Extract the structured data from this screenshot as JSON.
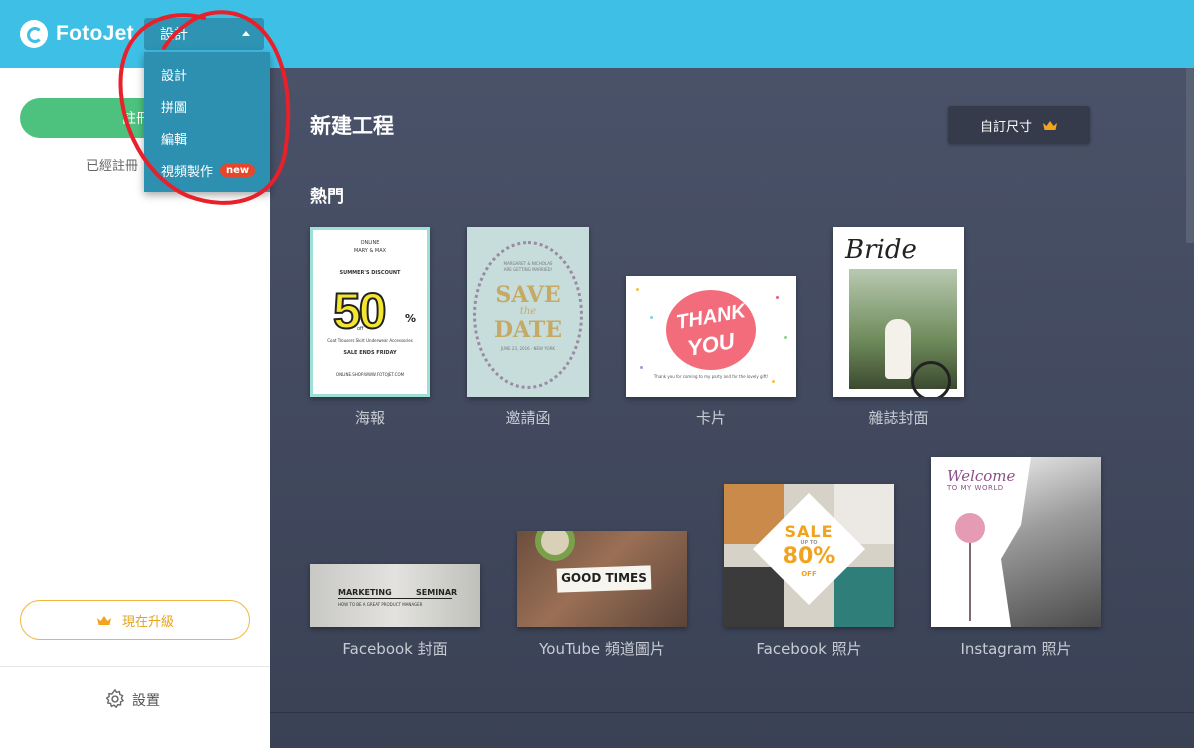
{
  "app": {
    "logo_text": "FotoJet",
    "mode_select_value": "設計"
  },
  "dropdown": {
    "items": [
      {
        "label": "設計"
      },
      {
        "label": "拼圖"
      },
      {
        "label": "編輯"
      },
      {
        "label": "視頻製作",
        "badge": "new"
      }
    ]
  },
  "sidebar": {
    "register_label": "註冊",
    "registered_text": "已經註冊",
    "upgrade_label": "現在升級",
    "settings_label": "設置"
  },
  "main": {
    "title": "新建工程",
    "custom_size_label": "自訂尺寸",
    "section_title": "熱門",
    "templates": [
      {
        "caption": "海報"
      },
      {
        "caption": "邀請函"
      },
      {
        "caption": "卡片"
      },
      {
        "caption": "雜誌封面"
      },
      {
        "caption": "Facebook 封面"
      },
      {
        "caption": "YouTube 頻道圖片"
      },
      {
        "caption": "Facebook 照片"
      },
      {
        "caption": "Instagram 照片"
      }
    ]
  },
  "thumbs": {
    "poster": {
      "top1": "ONLINE",
      "top2": "MARY & MAX",
      "discount": "SUMMER'S DISCOUNT",
      "big": "50",
      "pct": "%",
      "off": "off",
      "cats": "Coat   Trousers   Skirt   Underwear   Accessories",
      "ends": "SALE ENDS FRIDAY",
      "url": "ONLINE.SHOP.WWW.FOTOJET.COM"
    },
    "invite": {
      "names": "MARGARET & NICHOLAS",
      "getting": "ARE GETTING MARRIED!",
      "save": "SAVE",
      "the": "the",
      "date": "DATE",
      "when": "JUNE 23, 2016 · NEW YORK"
    },
    "card": {
      "thank": "THANK",
      "you": "YOU",
      "note": "Thank you for coming to my party and for the lovely gift!"
    },
    "magazine": {
      "title": "Bride"
    },
    "fbcover": {
      "left": "MARKETING",
      "right": "SEMINAR",
      "sub": "HOW TO BE A GREAT PRODUCT MANAGER"
    },
    "youtube": {
      "text": "GOOD TIMES"
    },
    "fbphoto": {
      "sale": "SALE",
      "up": "UP TO",
      "pct": "80%",
      "off": "OFF"
    },
    "insta": {
      "welcome": "Welcome",
      "sub": "TO MY WORLD"
    }
  },
  "colors": {
    "topbar": "#3ec0e6",
    "dropdown": "#2d90b1",
    "register_green": "#4cc27e",
    "upgrade_gold": "#f0b73b",
    "badge_red": "#e4472b",
    "annotation_red": "#e8202a"
  },
  "icons": [
    "fotojet-logo-icon",
    "caret-up-icon",
    "crown-icon",
    "gear-icon"
  ]
}
